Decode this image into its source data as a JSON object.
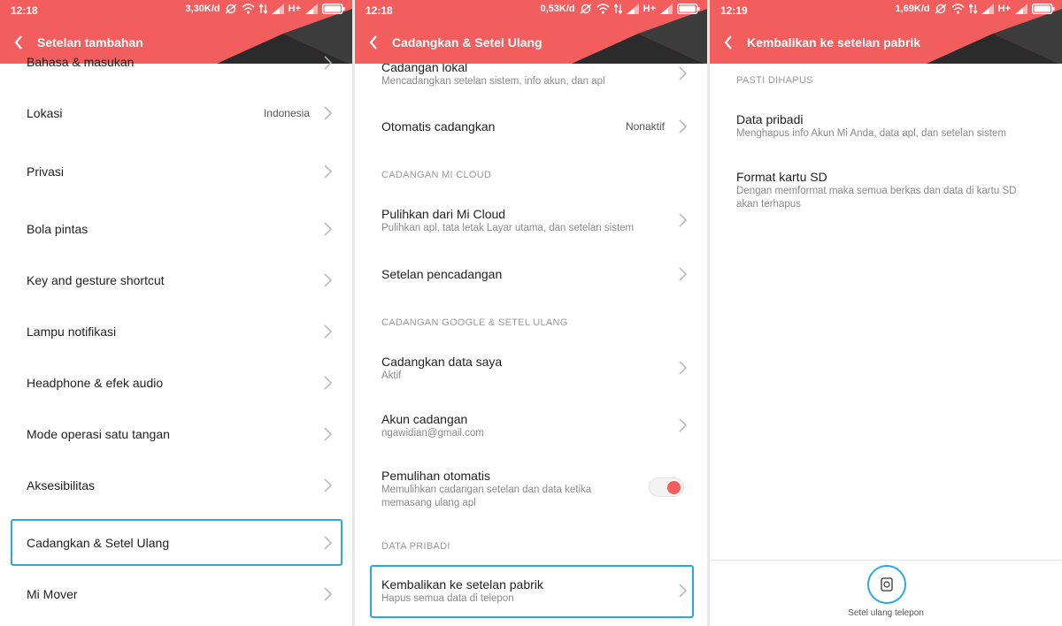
{
  "colors": {
    "accent": "#f25d5d",
    "highlight": "#2aa8df"
  },
  "panel1": {
    "status": {
      "time": "12:18",
      "speed": "3,30K/d",
      "network": "H+"
    },
    "title": "Setelan tambahan",
    "partial_top": "Bahasa & masukan",
    "items": [
      {
        "label": "Lokasi",
        "value": "Indonesia"
      },
      {
        "label": "Privasi"
      },
      {
        "label": "Bola pintas"
      },
      {
        "label": "Key and gesture shortcut"
      },
      {
        "label": "Lampu notifikasi"
      },
      {
        "label": "Headphone & efek audio"
      },
      {
        "label": "Mode operasi satu tangan"
      },
      {
        "label": "Aksesibilitas"
      },
      {
        "label": "Cadangkan & Setel Ulang"
      },
      {
        "label": "Mi Mover"
      }
    ]
  },
  "panel2": {
    "status": {
      "time": "12:18",
      "speed": "0,53K/d",
      "network": "H+"
    },
    "title": "Cadangkan & Setel Ulang",
    "partial_top": {
      "label": "Cadangan lokal",
      "sub": "Mencadangkan setelan sistem, info akun, dan apl"
    },
    "auto_backup": {
      "label": "Otomatis cadangkan",
      "value": "Nonaktif"
    },
    "section_mi_cloud": "CADANGAN MI CLOUD",
    "restore_mi_cloud": {
      "label": "Pulihkan dari Mi Cloud",
      "sub": "Pulihkan apl, tata letak Layar utama, dan setelan sistem"
    },
    "backup_settings": {
      "label": "Setelan pencadangan"
    },
    "section_google": "CADANGAN GOOGLE & SETEL ULANG",
    "backup_my_data": {
      "label": "Cadangkan data saya",
      "sub": "Aktif"
    },
    "backup_account": {
      "label": "Akun cadangan",
      "sub": "ngawidian@gmail.com"
    },
    "auto_restore": {
      "label": "Pemulihan otomatis",
      "sub1": "Memulihkan cadangan setelan dan data ketika",
      "sub2": "memasang ulang apl",
      "enabled": true
    },
    "section_personal": "DATA PRIBADI",
    "factory_reset": {
      "label": "Kembalikan ke setelan pabrik",
      "sub": "Hapus semua data di telepon"
    }
  },
  "panel3": {
    "status": {
      "time": "12:19",
      "speed": "1,69K/d",
      "network": "H+"
    },
    "title": "Kembalikan ke setelan pabrik",
    "section": "PASTI DIHAPUS",
    "personal_data": {
      "label": "Data pribadi",
      "sub": "Menghapus info Akun Mi Anda, data apl, dan setelan sistem"
    },
    "format_sd": {
      "label": "Format kartu SD",
      "sub1": "Dengan memformat maka semua berkas dan data di kartu SD",
      "sub2": "akan terhapus"
    },
    "reset_button_label": "Setel ulang telepon"
  }
}
